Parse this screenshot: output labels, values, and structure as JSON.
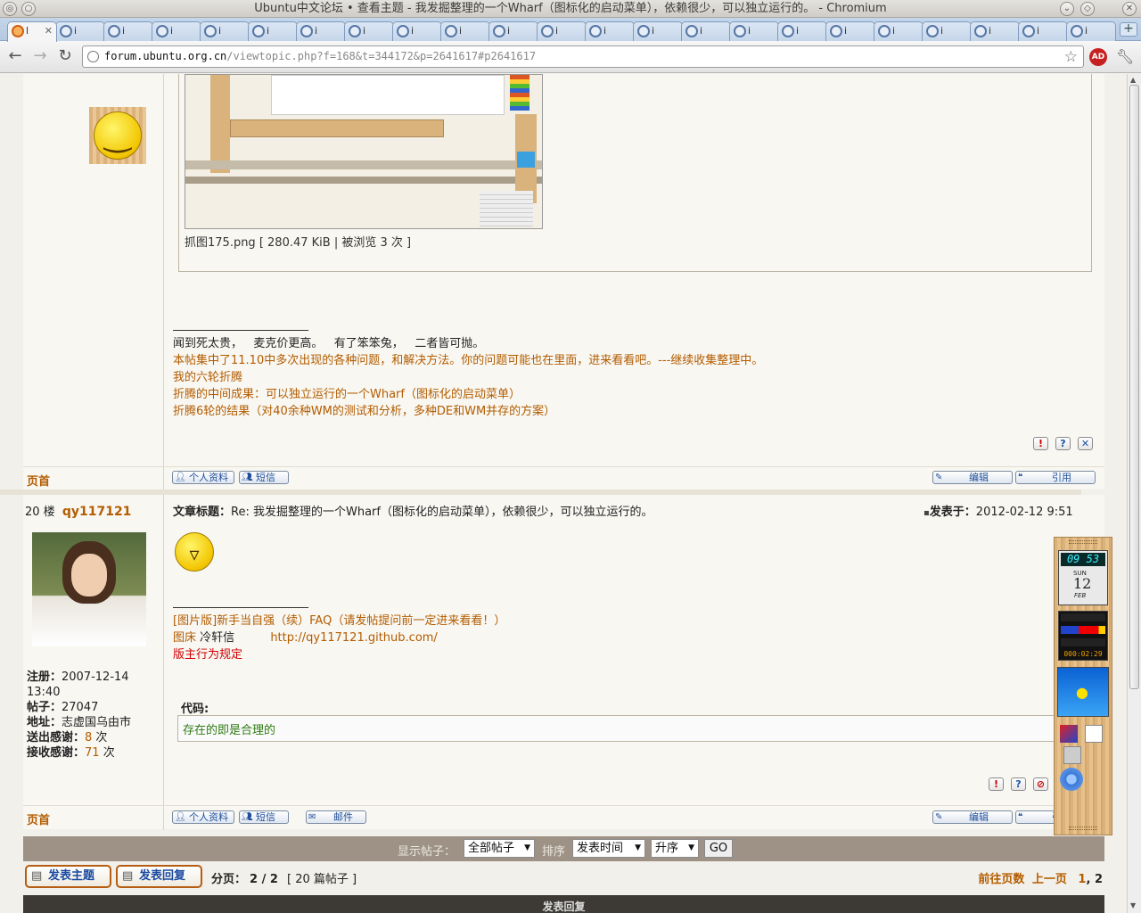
{
  "window": {
    "title": "Ubuntu中文论坛 • 查看主题 - 我发掘整理的一个Wharf（图标化的启动菜单），依赖很少，可以独立运行的。 - Chromium"
  },
  "tabs": {
    "active_label": "l",
    "inactive_label": "i",
    "new_tab": "+"
  },
  "address_bar": {
    "host": "forum.ubuntu.org.cn",
    "path": "/viewtopic.php?f=168&t=344172&p=2641617#p2641617"
  },
  "post1": {
    "attachment_caption": "抓图175.png [ 280.47 KiB | 被浏览 3 次 ]",
    "signature": {
      "line1": "闻到死太贵，   麦克价更高。   有了笨笨兔，   二者皆可抛。",
      "links": [
        "本帖集中了11.10中多次出现的各种问题，和解决方法。你的问题可能也在里面，进来看看吧。---继续收集整理中。",
        "我的六轮折腾",
        "折腾的中间成果：可以独立运行的一个Wharf（图标化的启动菜单）",
        "折腾6轮的结果（对40余种WM的测试和分析，多种DE和WM并存的方案）"
      ]
    },
    "footer": {
      "top_link": "页首",
      "profile": "个人资料",
      "pm": "短信",
      "edit": "编辑",
      "quote": "引用"
    }
  },
  "post2": {
    "floor": "20 楼",
    "author": "qy117121",
    "subject_label": "文章标题：",
    "subject": "Re: 我发掘整理的一个Wharf（图标化的启动菜单），依赖很少，可以独立运行的。",
    "posted_label": "发表于：",
    "posted_time": "2012-02-12 9:51",
    "profile": {
      "joined_label": "注册：",
      "joined": "2007-12-14 13:40",
      "posts_label": "帖子：",
      "posts": "27047",
      "location_label": "地址：",
      "location": "志虚国乌由市",
      "thanks_given_label": "送出感谢：",
      "thanks_given": "8",
      "thanks_given_unit": " 次",
      "thanks_received_label": "接收感谢：",
      "thanks_received": "71",
      "thanks_received_unit": " 次"
    },
    "signature": {
      "faq_link": "[图片版]新手当自强（续）FAQ（请发帖提问前一定进来看看！）",
      "host_label": "图床",
      "host_name": "冷轩信",
      "host_url": "http://qy117121.github.com/",
      "rules_link": "版主行为规定"
    },
    "code_label": "代码:",
    "code": "存在的即是合理的",
    "footer": {
      "top_link": "页首",
      "profile": "个人资料",
      "pm": "短信",
      "email": "邮件",
      "edit": "编辑",
      "quote": "引用"
    }
  },
  "dock": {
    "clock": "09 53",
    "day": "SUN",
    "date": "12",
    "month": "FEB",
    "timer": "000:02:29"
  },
  "display_bar": {
    "show_label": "显示帖子：",
    "show_value": "全部帖子",
    "sort_label": "排序",
    "sort_value": "发表时间",
    "order_value": "升序",
    "go": "GO"
  },
  "pagination": {
    "new_topic": "发表主题",
    "reply": "发表回复",
    "page_label": "分页：",
    "page_value": "2 / 2",
    "count": "[ 20 篇帖子 ]",
    "goto_label": "前往页数",
    "prev": "上一页",
    "page1": "1",
    "page2": "2"
  },
  "reply_header": "发表回复",
  "colors": {
    "accent_link": "#b35c00",
    "red_link": "#d00000",
    "bar": "#9d9285"
  }
}
